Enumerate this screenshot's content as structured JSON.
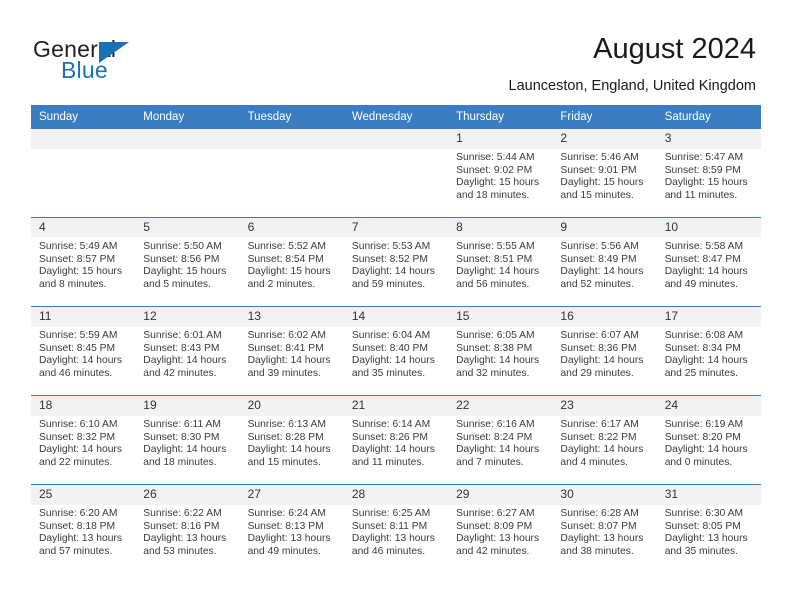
{
  "brand": {
    "name_top": "General",
    "name_bottom": "Blue",
    "accent_color": "#1a71b8"
  },
  "header": {
    "title": "August 2024",
    "subtitle": "Launceston, England, United Kingdom"
  },
  "theme": {
    "header_row_bg": "#3a7dc0",
    "daynum_bg": "#f2f2f2",
    "text_color": "#3b3b3b"
  },
  "calendar": {
    "weekday_headers": [
      "Sunday",
      "Monday",
      "Tuesday",
      "Wednesday",
      "Thursday",
      "Friday",
      "Saturday"
    ],
    "weeks": [
      [
        {
          "day": "",
          "sunrise": "",
          "sunset": "",
          "daylight1": "",
          "daylight2": ""
        },
        {
          "day": "",
          "sunrise": "",
          "sunset": "",
          "daylight1": "",
          "daylight2": ""
        },
        {
          "day": "",
          "sunrise": "",
          "sunset": "",
          "daylight1": "",
          "daylight2": ""
        },
        {
          "day": "",
          "sunrise": "",
          "sunset": "",
          "daylight1": "",
          "daylight2": ""
        },
        {
          "day": "1",
          "sunrise": "Sunrise: 5:44 AM",
          "sunset": "Sunset: 9:02 PM",
          "daylight1": "Daylight: 15 hours",
          "daylight2": "and 18 minutes."
        },
        {
          "day": "2",
          "sunrise": "Sunrise: 5:46 AM",
          "sunset": "Sunset: 9:01 PM",
          "daylight1": "Daylight: 15 hours",
          "daylight2": "and 15 minutes."
        },
        {
          "day": "3",
          "sunrise": "Sunrise: 5:47 AM",
          "sunset": "Sunset: 8:59 PM",
          "daylight1": "Daylight: 15 hours",
          "daylight2": "and 11 minutes."
        }
      ],
      [
        {
          "day": "4",
          "sunrise": "Sunrise: 5:49 AM",
          "sunset": "Sunset: 8:57 PM",
          "daylight1": "Daylight: 15 hours",
          "daylight2": "and 8 minutes."
        },
        {
          "day": "5",
          "sunrise": "Sunrise: 5:50 AM",
          "sunset": "Sunset: 8:56 PM",
          "daylight1": "Daylight: 15 hours",
          "daylight2": "and 5 minutes."
        },
        {
          "day": "6",
          "sunrise": "Sunrise: 5:52 AM",
          "sunset": "Sunset: 8:54 PM",
          "daylight1": "Daylight: 15 hours",
          "daylight2": "and 2 minutes."
        },
        {
          "day": "7",
          "sunrise": "Sunrise: 5:53 AM",
          "sunset": "Sunset: 8:52 PM",
          "daylight1": "Daylight: 14 hours",
          "daylight2": "and 59 minutes."
        },
        {
          "day": "8",
          "sunrise": "Sunrise: 5:55 AM",
          "sunset": "Sunset: 8:51 PM",
          "daylight1": "Daylight: 14 hours",
          "daylight2": "and 56 minutes."
        },
        {
          "day": "9",
          "sunrise": "Sunrise: 5:56 AM",
          "sunset": "Sunset: 8:49 PM",
          "daylight1": "Daylight: 14 hours",
          "daylight2": "and 52 minutes."
        },
        {
          "day": "10",
          "sunrise": "Sunrise: 5:58 AM",
          "sunset": "Sunset: 8:47 PM",
          "daylight1": "Daylight: 14 hours",
          "daylight2": "and 49 minutes."
        }
      ],
      [
        {
          "day": "11",
          "sunrise": "Sunrise: 5:59 AM",
          "sunset": "Sunset: 8:45 PM",
          "daylight1": "Daylight: 14 hours",
          "daylight2": "and 46 minutes."
        },
        {
          "day": "12",
          "sunrise": "Sunrise: 6:01 AM",
          "sunset": "Sunset: 8:43 PM",
          "daylight1": "Daylight: 14 hours",
          "daylight2": "and 42 minutes."
        },
        {
          "day": "13",
          "sunrise": "Sunrise: 6:02 AM",
          "sunset": "Sunset: 8:41 PM",
          "daylight1": "Daylight: 14 hours",
          "daylight2": "and 39 minutes."
        },
        {
          "day": "14",
          "sunrise": "Sunrise: 6:04 AM",
          "sunset": "Sunset: 8:40 PM",
          "daylight1": "Daylight: 14 hours",
          "daylight2": "and 35 minutes."
        },
        {
          "day": "15",
          "sunrise": "Sunrise: 6:05 AM",
          "sunset": "Sunset: 8:38 PM",
          "daylight1": "Daylight: 14 hours",
          "daylight2": "and 32 minutes."
        },
        {
          "day": "16",
          "sunrise": "Sunrise: 6:07 AM",
          "sunset": "Sunset: 8:36 PM",
          "daylight1": "Daylight: 14 hours",
          "daylight2": "and 29 minutes."
        },
        {
          "day": "17",
          "sunrise": "Sunrise: 6:08 AM",
          "sunset": "Sunset: 8:34 PM",
          "daylight1": "Daylight: 14 hours",
          "daylight2": "and 25 minutes."
        }
      ],
      [
        {
          "day": "18",
          "sunrise": "Sunrise: 6:10 AM",
          "sunset": "Sunset: 8:32 PM",
          "daylight1": "Daylight: 14 hours",
          "daylight2": "and 22 minutes."
        },
        {
          "day": "19",
          "sunrise": "Sunrise: 6:11 AM",
          "sunset": "Sunset: 8:30 PM",
          "daylight1": "Daylight: 14 hours",
          "daylight2": "and 18 minutes."
        },
        {
          "day": "20",
          "sunrise": "Sunrise: 6:13 AM",
          "sunset": "Sunset: 8:28 PM",
          "daylight1": "Daylight: 14 hours",
          "daylight2": "and 15 minutes."
        },
        {
          "day": "21",
          "sunrise": "Sunrise: 6:14 AM",
          "sunset": "Sunset: 8:26 PM",
          "daylight1": "Daylight: 14 hours",
          "daylight2": "and 11 minutes."
        },
        {
          "day": "22",
          "sunrise": "Sunrise: 6:16 AM",
          "sunset": "Sunset: 8:24 PM",
          "daylight1": "Daylight: 14 hours",
          "daylight2": "and 7 minutes."
        },
        {
          "day": "23",
          "sunrise": "Sunrise: 6:17 AM",
          "sunset": "Sunset: 8:22 PM",
          "daylight1": "Daylight: 14 hours",
          "daylight2": "and 4 minutes."
        },
        {
          "day": "24",
          "sunrise": "Sunrise: 6:19 AM",
          "sunset": "Sunset: 8:20 PM",
          "daylight1": "Daylight: 14 hours",
          "daylight2": "and 0 minutes."
        }
      ],
      [
        {
          "day": "25",
          "sunrise": "Sunrise: 6:20 AM",
          "sunset": "Sunset: 8:18 PM",
          "daylight1": "Daylight: 13 hours",
          "daylight2": "and 57 minutes."
        },
        {
          "day": "26",
          "sunrise": "Sunrise: 6:22 AM",
          "sunset": "Sunset: 8:16 PM",
          "daylight1": "Daylight: 13 hours",
          "daylight2": "and 53 minutes."
        },
        {
          "day": "27",
          "sunrise": "Sunrise: 6:24 AM",
          "sunset": "Sunset: 8:13 PM",
          "daylight1": "Daylight: 13 hours",
          "daylight2": "and 49 minutes."
        },
        {
          "day": "28",
          "sunrise": "Sunrise: 6:25 AM",
          "sunset": "Sunset: 8:11 PM",
          "daylight1": "Daylight: 13 hours",
          "daylight2": "and 46 minutes."
        },
        {
          "day": "29",
          "sunrise": "Sunrise: 6:27 AM",
          "sunset": "Sunset: 8:09 PM",
          "daylight1": "Daylight: 13 hours",
          "daylight2": "and 42 minutes."
        },
        {
          "day": "30",
          "sunrise": "Sunrise: 6:28 AM",
          "sunset": "Sunset: 8:07 PM",
          "daylight1": "Daylight: 13 hours",
          "daylight2": "and 38 minutes."
        },
        {
          "day": "31",
          "sunrise": "Sunrise: 6:30 AM",
          "sunset": "Sunset: 8:05 PM",
          "daylight1": "Daylight: 13 hours",
          "daylight2": "and 35 minutes."
        }
      ]
    ]
  }
}
